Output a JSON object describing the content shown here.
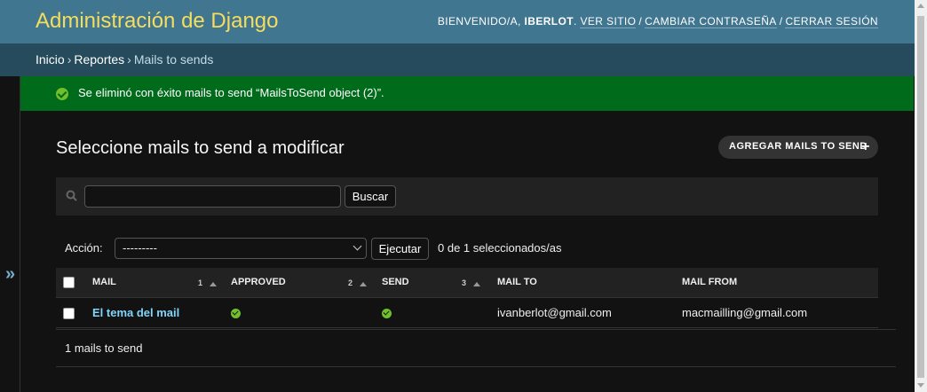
{
  "header": {
    "site_name": "Administración de Django",
    "welcome": "Bienvenido/a,",
    "username": "iberlot",
    "view_site": "Ver sitio",
    "change_password": "Cambiar contraseña",
    "logout": "Cerrar sesión"
  },
  "breadcrumbs": {
    "home": "Inicio",
    "app": "Reportes",
    "current": "Mails to sends",
    "separator": "›"
  },
  "nav_toggle": {
    "label": "»"
  },
  "message": {
    "text": "Se eliminó con éxito mails to send “MailsToSend object (2)”.",
    "status": "success"
  },
  "content": {
    "title": "Seleccione mails to send a modificar",
    "add_button": "Agregar mails to send",
    "add_icon": "+"
  },
  "search": {
    "value": "",
    "button": "Buscar"
  },
  "actions": {
    "label": "Acción:",
    "selected": "---------",
    "execute": "Ejecutar",
    "counter": "0 de 1 seleccionados/as"
  },
  "table": {
    "columns": [
      {
        "label": "Mail",
        "sort_priority": "1"
      },
      {
        "label": "Approved",
        "sort_priority": "2"
      },
      {
        "label": "Send",
        "sort_priority": "3"
      },
      {
        "label": "Mail to",
        "sort_priority": ""
      },
      {
        "label": "Mail from",
        "sort_priority": ""
      }
    ],
    "rows": [
      {
        "mail": "El tema del mail",
        "approved": true,
        "send": true,
        "mail_to": "ivanberlot@gmail.com",
        "mail_from": "macmailling@gmail.com"
      }
    ]
  },
  "paginator": {
    "text": "1 mails to send"
  },
  "colors": {
    "header_bg": "#417690",
    "branding": "#f5dd5d",
    "breadcrumbs_bg": "#264b5d",
    "success_bg": "#006b1b",
    "link": "#81d4fa",
    "page_bg": "#121212"
  }
}
